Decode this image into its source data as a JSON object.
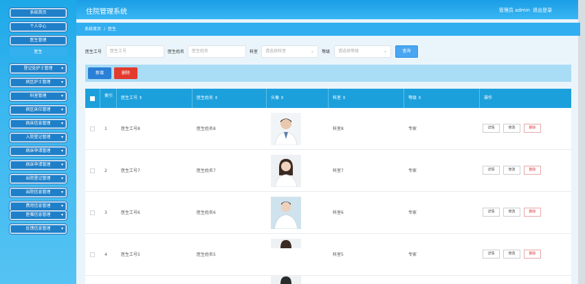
{
  "app": {
    "title": "住院管理系统"
  },
  "header": {
    "user_label": "管理员 admin",
    "logout": "退出登录"
  },
  "sidebar": {
    "items": [
      {
        "label": "系统首页"
      },
      {
        "label": "个人中心"
      },
      {
        "label": "医生管理"
      },
      {
        "label": "医生"
      },
      {
        "label": "登记处护士管理"
      },
      {
        "label": "病区护士管理"
      },
      {
        "label": "科室管理"
      },
      {
        "label": "病区床位管理"
      },
      {
        "label": "病床信息管理"
      },
      {
        "label": "入院登记管理"
      },
      {
        "label": "病床申请管理"
      },
      {
        "label": "病床申请管理"
      },
      {
        "label": "出院登记管理"
      },
      {
        "label": "出院信息管理"
      },
      {
        "label": "费用信息管理"
      },
      {
        "label": "医嘱信息管理"
      },
      {
        "label": "反馈信息管理"
      }
    ]
  },
  "breadcrumb": {
    "home": "系统首页",
    "current": "医生"
  },
  "search": {
    "f1_label": "医生工号",
    "f1_placeholder": "医生工号",
    "f2_label": "医生姓名",
    "f2_placeholder": "医生姓名",
    "f3_label": "科室",
    "f3_placeholder": "请选择科室",
    "f4_label": "等级",
    "f4_placeholder": "请选择等级",
    "button": "查询"
  },
  "actions": {
    "add": "新增",
    "delete": "删除"
  },
  "table": {
    "headers": [
      "索引",
      "医生工号 ⇕",
      "医生姓名 ⇕",
      "头像 ⇕",
      "科室 ⇕",
      "等级 ⇕",
      "操作"
    ],
    "rows": [
      {
        "index": "1",
        "id": "医生工号8",
        "name": "医生姓名8",
        "dept": "科室8",
        "level": "专家"
      },
      {
        "index": "2",
        "id": "医生工号7",
        "name": "医生姓名7",
        "dept": "科室7",
        "level": "专家"
      },
      {
        "index": "3",
        "id": "医生工号6",
        "name": "医生姓名6",
        "dept": "科室6",
        "level": "专家"
      },
      {
        "index": "4",
        "id": "医生工号5",
        "name": "医生姓名5",
        "dept": "科室5",
        "level": "专家"
      }
    ],
    "ops": {
      "detail": "详情",
      "edit": "修改",
      "delete": "删除"
    }
  }
}
